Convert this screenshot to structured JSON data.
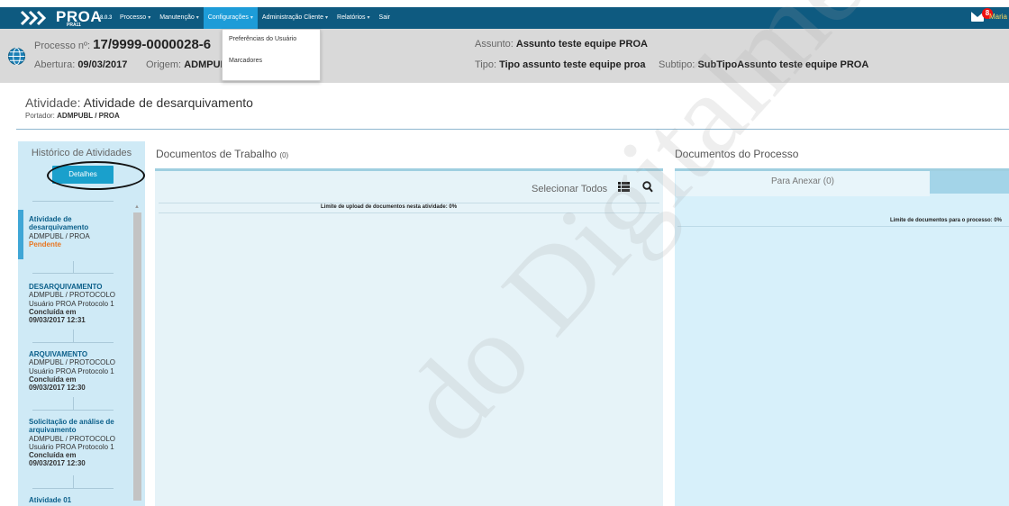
{
  "nav": {
    "brand": "PROA",
    "brand_sub": "PRA11",
    "version": "8.0.3",
    "menu": [
      {
        "label": "Processo"
      },
      {
        "label": "Manutenção"
      },
      {
        "label": "Configurações"
      },
      {
        "label": "Administração Cliente"
      },
      {
        "label": "Relatórios"
      },
      {
        "label": "Sair"
      }
    ],
    "mail_count": "8",
    "user": "Maria"
  },
  "dropdown": {
    "items": [
      "Preferências do Usuário",
      "Marcadores"
    ]
  },
  "process": {
    "number_label": "Processo nº:",
    "number": "17/9999-0000028-6",
    "opening_label": "Abertura:",
    "opening": "09/03/2017",
    "origin_label": "Origem:",
    "origin": "ADMPUBL",
    "subject_label": "Assunto:",
    "subject": "Assunto teste equipe PROA",
    "type_label": "Tipo:",
    "type": "Tipo assunto teste equipe proa",
    "subtype_label": "Subtipo:",
    "subtype": "SubTipoAssunto teste equipe PROA"
  },
  "activity": {
    "label": "Atividade:",
    "name": "Atividade de desarquivamento",
    "holder_label": "Portador:",
    "holder": "ADMPUBL / PROA"
  },
  "history": {
    "title": "Histórico de Atividades",
    "details_button": "Detalhes",
    "entries": [
      {
        "h1": "Atividade de",
        "h2": "desarquivamento",
        "l1": "ADMPUBL / PROA",
        "status": "Pendente"
      },
      {
        "h1": "DESARQUIVAMENTO",
        "l1": "ADMPUBL / PROTOCOLO",
        "l2": "Usuário PROA Protocolo 1",
        "status": "Concluída em",
        "date": "09/03/2017 12:31"
      },
      {
        "h1": "ARQUIVAMENTO",
        "l1": "ADMPUBL / PROTOCOLO",
        "l2": "Usuário PROA Protocolo 1",
        "status": "Concluída em",
        "date": "09/03/2017 12:30"
      },
      {
        "h1": "Solicitação de análise de",
        "h2": "arquivamento",
        "l1": "ADMPUBL / PROTOCOLO",
        "l2": "Usuário PROA Protocolo 1",
        "status": "Concluída em",
        "date": "09/03/2017 12:30"
      },
      {
        "h1": "Atividade 01"
      }
    ]
  },
  "work_docs": {
    "title": "Documentos de Trabalho",
    "count": "(0)",
    "select_all": "Selecionar Todos",
    "limit": "Limite de upload de documentos nesta atividade: 0%"
  },
  "process_docs": {
    "title": "Documentos do Processo",
    "tab": "Para Anexar (0)",
    "limit": "Limite de documentos para o processo: 0%"
  },
  "watermark": "do Digitalme",
  "colors": {
    "nav_bg": "#0e5a80",
    "nav_active": "#1d9cd8",
    "header_bg": "#d9d9d9",
    "accent": "#1aa0cc",
    "pending": "#e87722"
  }
}
